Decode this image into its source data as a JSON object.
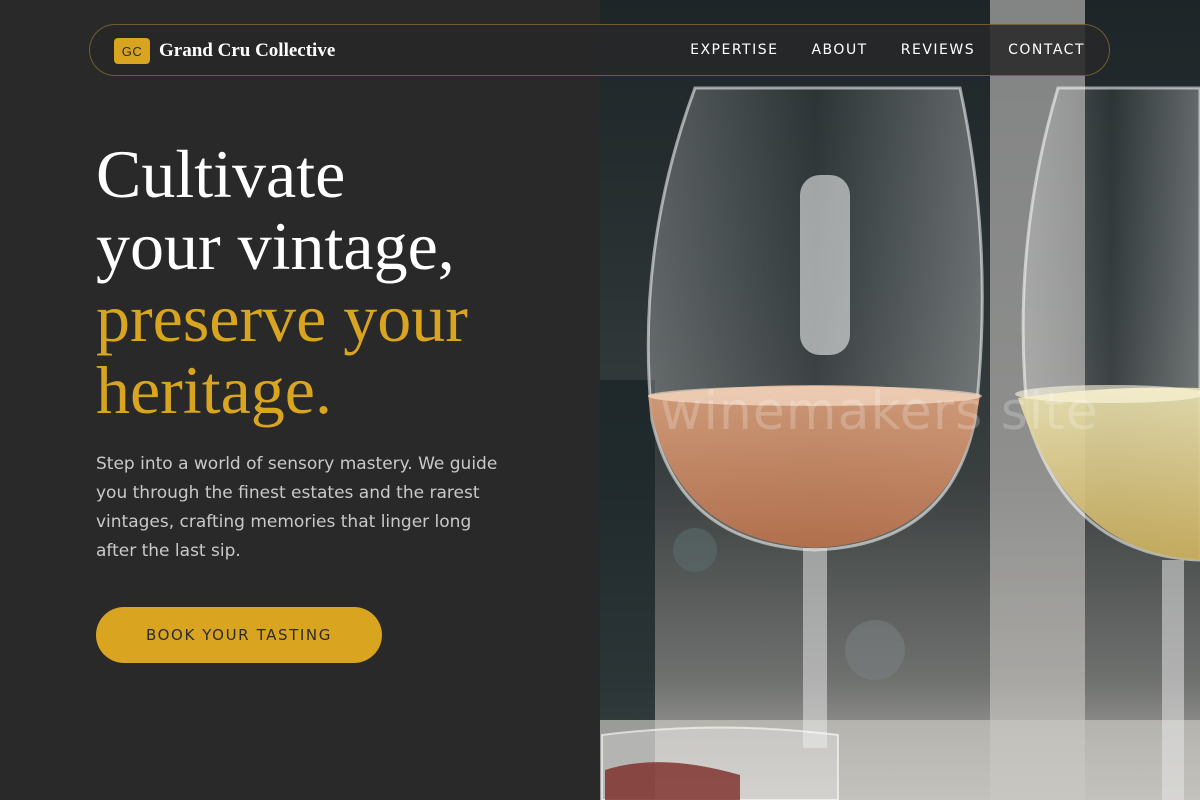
{
  "brand": {
    "badge": "GC",
    "name": "Grand Cru Collective",
    "accent_color": "#d9a521"
  },
  "nav": {
    "links": [
      "EXPERTISE",
      "ABOUT",
      "REVIEWS",
      "CONTACT"
    ]
  },
  "hero": {
    "headline_lines": [
      "Cultivate",
      "your vintage,",
      "preserve your",
      "heritage."
    ],
    "description": "Step into a world of sensory mastery. We guide you through the finest estates and the rarest vintages, crafting memories that linger long after the last sip.",
    "cta_label": "BOOK YOUR TASTING"
  },
  "photo": {
    "subject": "two wine glasses with rosé and white wine",
    "watermark": "winemakers site"
  },
  "colors": {
    "background": "#292929",
    "text": "#ffffff",
    "muted_text": "#c9c9c9"
  }
}
